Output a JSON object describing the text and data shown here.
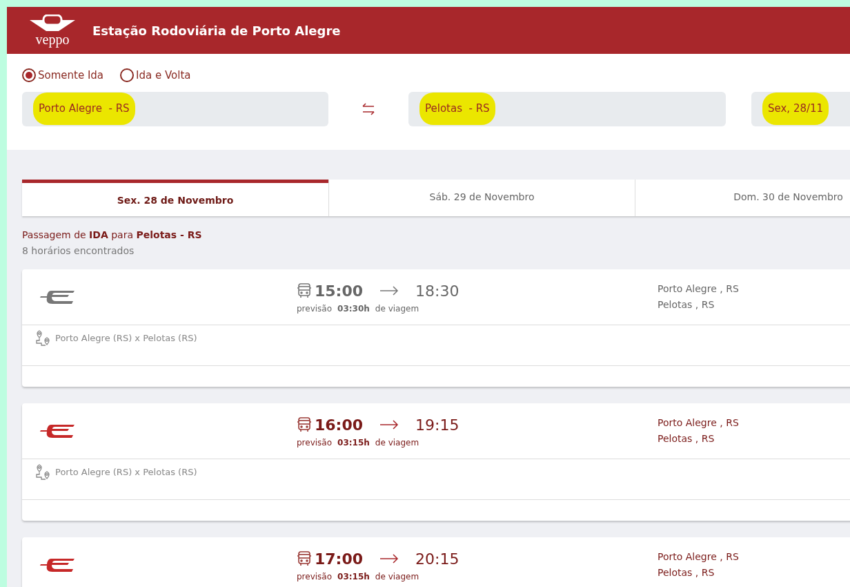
{
  "header": {
    "title": "Estação Rodoviária de Porto Alegre",
    "logo_text": "veppo"
  },
  "trip_type": [
    {
      "label": "Somente Ida",
      "selected": true
    },
    {
      "label": "Ida e Volta",
      "selected": false
    }
  ],
  "search": {
    "origin": {
      "value": "Porto Alegre  - RS",
      "highlighted": true
    },
    "destination": {
      "value": "Pelotas  - RS",
      "highlighted": true
    },
    "date": {
      "value": "Sex, 28/11",
      "highlighted": true
    }
  },
  "date_tabs": [
    {
      "label": "Sex. 28 de Novembro",
      "selected": true
    },
    {
      "label": "Sáb. 29 de Novembro",
      "selected": false
    },
    {
      "label": "Dom. 30 de Novembro",
      "selected": false
    }
  ],
  "summary": {
    "title": "Passagem de **IDA** para **Pelotas - RS**",
    "count": "8 horários encontrados"
  },
  "trips": [
    {
      "disabled": true,
      "departure": "15:00",
      "arrival": "18:30",
      "duration_prefix": "previsão",
      "duration": "03:30h",
      "duration_suffix": "de viagem",
      "origin": "Porto Alegre , RS",
      "destination": "Pelotas , RS",
      "route": "Porto Alegre (RS) x Pelotas (RS)"
    },
    {
      "disabled": false,
      "departure": "16:00",
      "arrival": "19:15",
      "duration_prefix": "previsão",
      "duration": "03:15h",
      "duration_suffix": "de viagem",
      "origin": "Porto Alegre , RS",
      "destination": "Pelotas , RS",
      "route": "Porto Alegre (RS) x Pelotas (RS)"
    },
    {
      "disabled": false,
      "departure": "17:00",
      "arrival": "20:15",
      "duration_prefix": "previsão",
      "duration": "03:15h",
      "duration_suffix": "de viagem",
      "origin": "Porto Alegre , RS",
      "destination": "Pelotas , RS"
    }
  ]
}
